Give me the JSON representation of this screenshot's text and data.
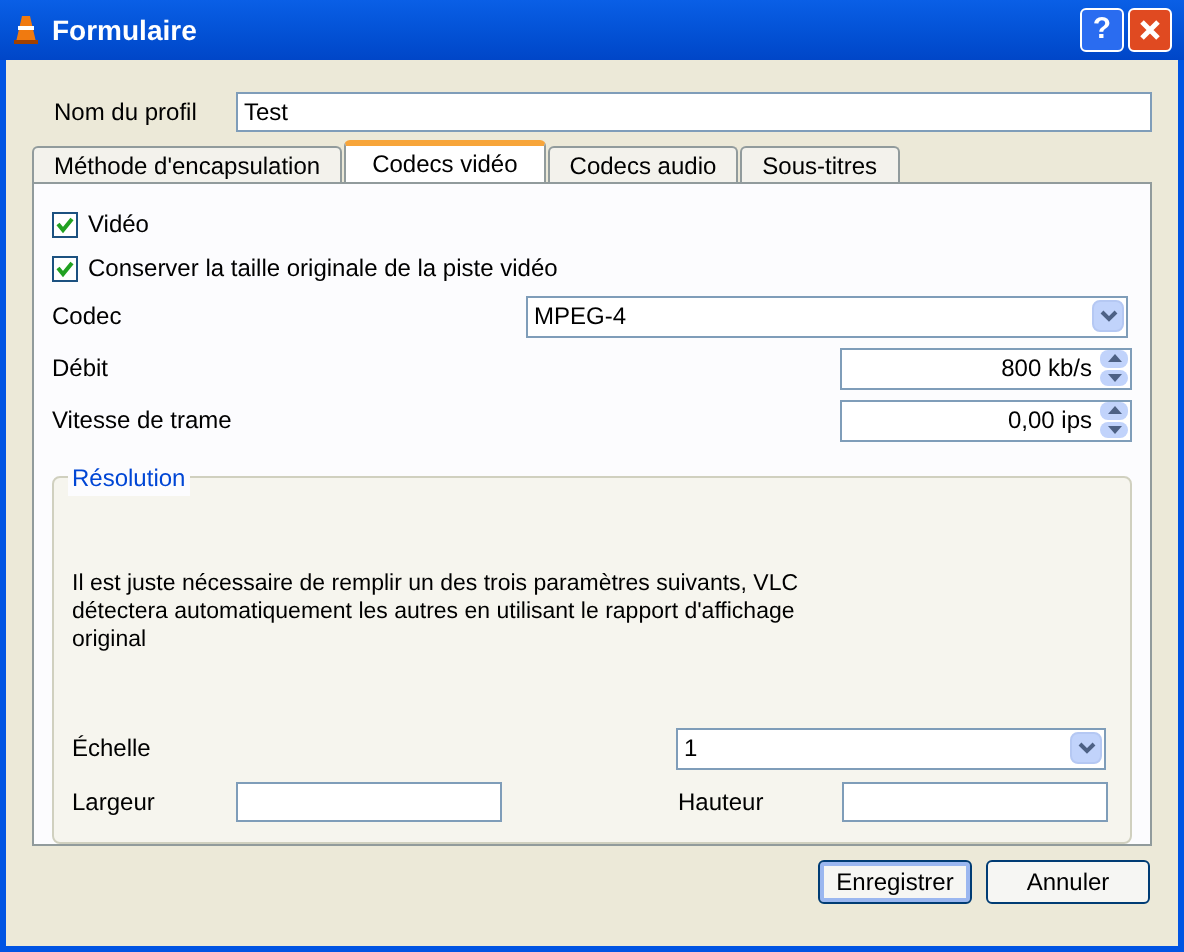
{
  "window": {
    "title": "Formulaire",
    "help": "?"
  },
  "profile": {
    "label": "Nom du profil",
    "value": "Test"
  },
  "tabs": [
    {
      "label": "Méthode d'encapsulation",
      "selected": false
    },
    {
      "label": "Codecs vidéo",
      "selected": true
    },
    {
      "label": "Codecs audio",
      "selected": false
    },
    {
      "label": "Sous-titres",
      "selected": false
    }
  ],
  "checkboxes": [
    {
      "label": "Vidéo",
      "checked": true
    },
    {
      "label": "Conserver la taille originale de la piste vidéo",
      "checked": true
    }
  ],
  "codec": {
    "label": "Codec",
    "value": "MPEG-4"
  },
  "bitrate": {
    "label": "Débit",
    "value": "800 kb/s"
  },
  "framerate": {
    "label": "Vitesse de trame",
    "value": "0,00 ips"
  },
  "resolution": {
    "title": "Résolution",
    "note": "Il est juste nécessaire de remplir un des trois paramètres suivants, VLC détectera automatiquement les autres en utilisant le rapport d'affichage original",
    "scale": {
      "label": "Échelle",
      "value": "1"
    },
    "width": {
      "label": "Largeur"
    },
    "height": {
      "label": "Hauteur"
    }
  },
  "buttons": [
    {
      "label": "Enregistrer",
      "default": true
    },
    {
      "label": "Annuler",
      "default": false
    }
  ]
}
